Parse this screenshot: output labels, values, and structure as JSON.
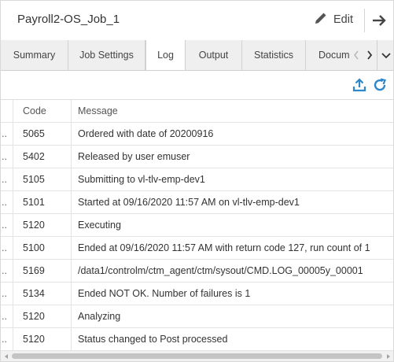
{
  "header": {
    "title": "Payroll2-OS_Job_1",
    "edit_label": "Edit",
    "edit_icon": "pencil-icon",
    "nav_icon": "arrow-right-icon"
  },
  "tabs": [
    {
      "label": "Summary",
      "active": false
    },
    {
      "label": "Job Settings",
      "active": false
    },
    {
      "label": "Log",
      "active": true
    },
    {
      "label": "Output",
      "active": false
    },
    {
      "label": "Statistics",
      "active": false
    },
    {
      "label": "Docum",
      "active": false
    }
  ],
  "tab_controls": {
    "prev_icon": "chevron-left-icon",
    "next_icon": "chevron-right-icon",
    "menu_icon": "chevron-down-icon"
  },
  "toolbar": {
    "export_icon": "export-icon",
    "refresh_icon": "refresh-icon"
  },
  "table": {
    "columns": [
      "Code",
      "Message"
    ],
    "truncated_cell": "..",
    "rows": [
      {
        "code": "5065",
        "message": "Ordered with date of 20200916"
      },
      {
        "code": "5402",
        "message": "Released by user emuser"
      },
      {
        "code": "5105",
        "message": "Submitting to vl-tlv-emp-dev1"
      },
      {
        "code": "5101",
        "message": "Started at 09/16/2020 11:57 AM on vl-tlv-emp-dev1"
      },
      {
        "code": "5120",
        "message": "Executing"
      },
      {
        "code": "5100",
        "message": "Ended at 09/16/2020 11:57 AM with return code 127, run count of 1"
      },
      {
        "code": "5169",
        "message": "/data1/controlm/ctm_agent/ctm/sysout/CMD.LOG_00005y_00001"
      },
      {
        "code": "5134",
        "message": "Ended NOT OK. Number of failures is 1"
      },
      {
        "code": "5120",
        "message": "Analyzing"
      },
      {
        "code": "5120",
        "message": "Status changed to Post processed"
      }
    ]
  },
  "colors": {
    "accent": "#2f86c8",
    "tab_bar": "#efefef",
    "border": "#dcdcdc",
    "text": "#333333"
  }
}
